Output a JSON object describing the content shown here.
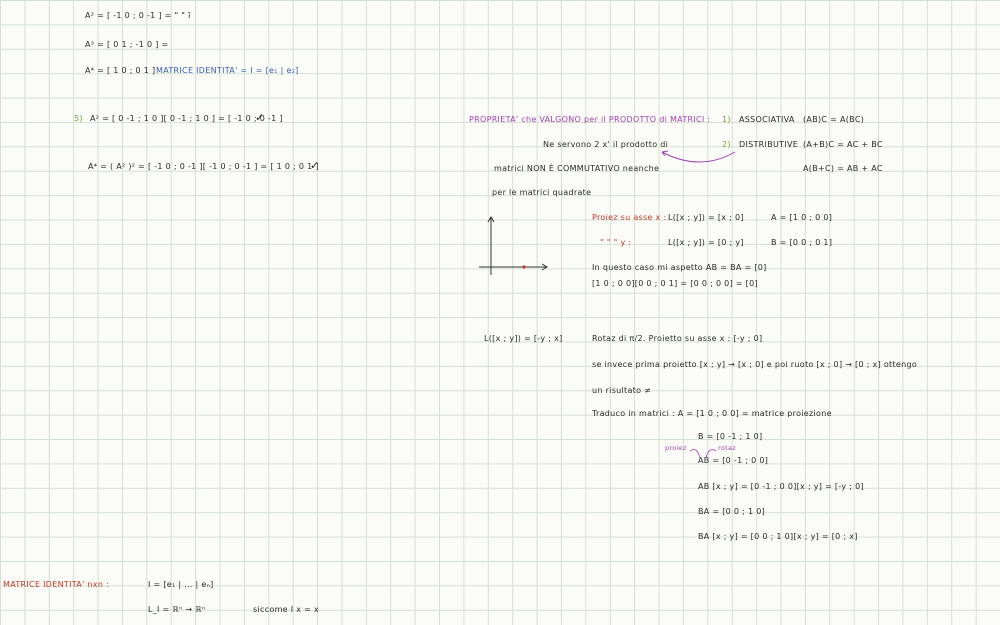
{
  "left_top": {
    "a2_line": "A² = [ -1 0 ; 0 -1 ] = \" \" ĩ",
    "a3_line": "A³ = [ 0 1 ; -1 0 ] =",
    "a4_line": "A⁴ = [ 1 0 ; 0 1 ]",
    "identity_label": "MATRICE IDENTITA' = I = [e₁ | e₂]",
    "item5_num": "5)",
    "item5_line": "A² = [ 0 -1 ; 1 0 ][ 0 -1 ; 1 0 ] = [ -1 0 ; 0 -1 ]",
    "check1": "✓",
    "a4_expand": "A⁴ = ( A² )² = [ -1 0 ; 0 -1 ][ -1 0 ; 0 -1 ] = [ 1 0 ; 0 1 ]",
    "check2": "✓"
  },
  "properties": {
    "heading": "PROPRIETA' che VALGONO per il PRODOTTO di MATRICI :",
    "p1_num": "1)",
    "p1_name": "ASSOCIATIVA",
    "p1_formula": "(AB)C = A(BC)",
    "p2_num": "2)",
    "p2_name": "DISTRIBUTIVE",
    "p2_formula": "(A+B)C = AC + BC",
    "p2_formula_b": "A(B+C) = AB + AC",
    "note_needed": "Ne servono 2 x' il prodotto di",
    "note_not_comm": "matrici NON È COMMUTATIVO neanche",
    "note_square": "per le matrici quadrate"
  },
  "projection": {
    "proj_x": "Proiez su asse x :",
    "proj_x_formula": "L([x ; y]) = [x ; 0]",
    "matrix_a": "A = [1 0 ; 0 0]",
    "proj_y_prefix": "\" \" \" y :",
    "proj_y_formula": "L([x ; y]) = [0 ; y]",
    "matrix_b": "B = [0 0 ; 0 1]",
    "case_text": "In questo caso mi aspetto  AB = BA = [0]",
    "product": "[1 0 ; 0 0][0 0 ; 0 1] = [0 0 ; 0 0] = [0]"
  },
  "rotation": {
    "l_map": "L([x ; y]) = [-y ; x]",
    "rotat": "Rotaz di π/2. Proietto su asse x : [-y ; 0]",
    "instead": "se invece prima proietto [x ; y] → [x ; 0] e poi ruoto [x ; 0] → [0 ; x] ottengo",
    "result": "un risultato ≠",
    "translate": "Traduco in matrici :  A = [1 0 ; 0 0]  = matrice proiezione",
    "b_matrix": "B = [0 -1 ; 1 0]",
    "label_proiez": "proiez",
    "label_rotaz": "rotaz",
    "ab_matrix": "AB = [0 -1 ; 0 0]",
    "ab_apply": "AB [x ; y] = [0 -1 ; 0 0][x ; y] = [-y ; 0]",
    "ba_matrix": "BA = [0 0 ; 1 0]",
    "ba_apply": "BA [x ; y] = [0 0 ; 1 0][x ; y] = [0 ; x]"
  },
  "identity_nxn": {
    "label": "MATRICE IDENTITA' nxn :",
    "formula": "I = [e₁ | ... | eₙ]",
    "map": "L_I = ℝⁿ → ℝⁿ",
    "since": "siccome  I x = x"
  },
  "colors": {
    "blue": "#3a5fb0",
    "red": "#c0392b",
    "purple": "#a13fb5",
    "green": "#6aa842"
  }
}
